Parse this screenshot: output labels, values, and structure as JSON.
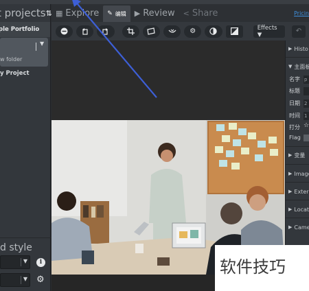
{
  "left_panel": {
    "projects_title": "t projects",
    "sort_icon": "sort-icon",
    "portfolio_label": "ple Portfolio",
    "new_folder": "w folder",
    "my_project": "y Project",
    "style_title": "d style"
  },
  "tabs": [
    {
      "label": "Explore",
      "icon": "grid-icon"
    },
    {
      "label": "编辑",
      "icon": "pencil-icon"
    },
    {
      "label": "Review",
      "icon": "play-icon"
    },
    {
      "label": "Share",
      "icon": "share-icon"
    }
  ],
  "pricing": "Pricin",
  "toolbar": {
    "effects_label": "Effects ▼"
  },
  "right_panel": {
    "history": "Histo",
    "main_section": "主面板",
    "fields": [
      {
        "label": "名字",
        "value": "p"
      },
      {
        "label": "标题",
        "value": ""
      },
      {
        "label": "日期",
        "value": "2"
      },
      {
        "label": "时间",
        "value": "1"
      }
    ],
    "rating_label": "打分",
    "flag_label": "Flag",
    "sections": [
      "变量",
      "Image",
      "Exter",
      "Locat",
      "Came"
    ]
  },
  "watermark": "软件技巧",
  "colors": {
    "accent_link": "#3e8fdd",
    "active_tab": "#44484e",
    "panel_bg": "#33373c",
    "arrow": "#3d5fd6"
  }
}
